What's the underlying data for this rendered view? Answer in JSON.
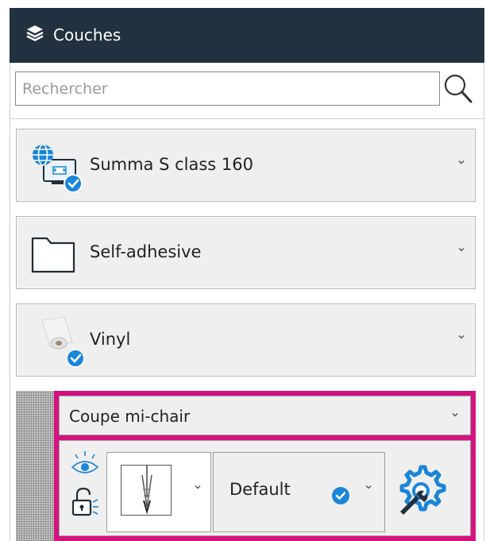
{
  "header": {
    "title": "Couches",
    "icon": "layers-icon"
  },
  "search": {
    "placeholder": "Rechercher",
    "value": ""
  },
  "cards": [
    {
      "label": "Summa S class 160",
      "icon": "cutter-device-icon",
      "status": "checked"
    },
    {
      "label": "Self-adhesive",
      "icon": "folder-icon"
    },
    {
      "label": "Vinyl",
      "icon": "vinyl-roll-icon",
      "status": "checked"
    }
  ],
  "selected_layer": {
    "cut_mode": "Coupe mi-chair",
    "tool_icon": "blade-tool-icon",
    "preset": "Default",
    "preset_status": "checked",
    "visibility_icon": "eye-icon",
    "lock_icon": "unlock-icon",
    "settings_icon": "wrench-gear-icon"
  },
  "colors": {
    "header_bg": "#22313f",
    "selection": "#d4127f",
    "check": "#1a86d8",
    "settings": "#1a86d8"
  }
}
